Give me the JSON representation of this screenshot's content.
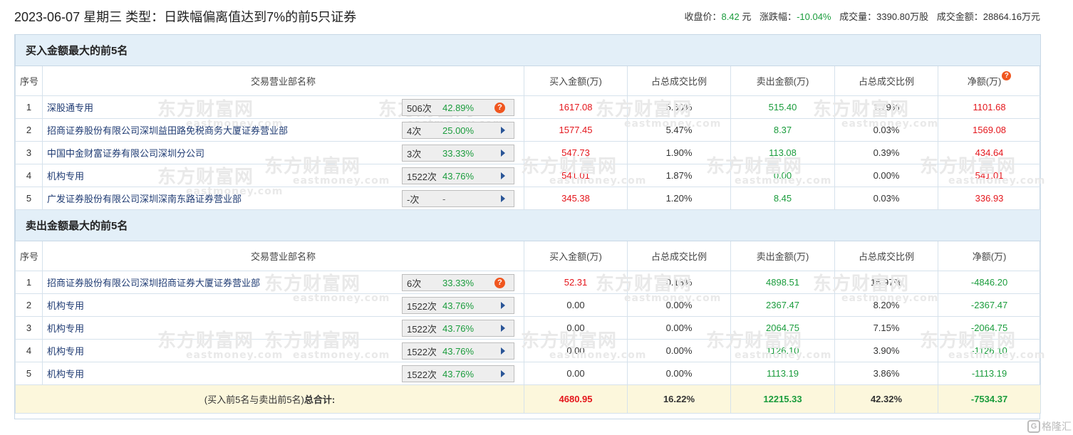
{
  "header": {
    "title": "2023-06-07 星期三 类型：日跌幅偏离值达到7%的前5只证券",
    "close_label": "收盘价：",
    "close_value": "8.42",
    "close_unit": "元",
    "change_label": "涨跌幅：",
    "change_value": "-10.04%",
    "volume_label": "成交量：",
    "volume_value": "3390.80万股",
    "amount_label": "成交金额：",
    "amount_value": "28864.16万元"
  },
  "columns": {
    "idx": "序号",
    "name": "交易营业部名称",
    "buy": "买入金额(万)",
    "buy_ratio": "占总成交比例",
    "sell": "卖出金额(万)",
    "sell_ratio": "占总成交比例",
    "net": "净额(万)"
  },
  "buy_section": {
    "title": "买入金额最大的前5名",
    "rows": [
      {
        "idx": "1",
        "name": "深股通专用",
        "times": "506次",
        "rate": "42.89%",
        "icon": "question-icon",
        "buy": "1617.08",
        "buy_ratio": "5.60%",
        "sell": "515.40",
        "sell_ratio": "1.79%",
        "net": "1101.68"
      },
      {
        "idx": "2",
        "name": "招商证券股份有限公司深圳益田路免税商务大厦证券营业部",
        "times": "4次",
        "rate": "25.00%",
        "icon": "arrow-right-icon",
        "buy": "1577.45",
        "buy_ratio": "5.47%",
        "sell": "8.37",
        "sell_ratio": "0.03%",
        "net": "1569.08"
      },
      {
        "idx": "3",
        "name": "中国中金财富证券有限公司深圳分公司",
        "times": "3次",
        "rate": "33.33%",
        "icon": "arrow-right-icon",
        "buy": "547.73",
        "buy_ratio": "1.90%",
        "sell": "113.08",
        "sell_ratio": "0.39%",
        "net": "434.64"
      },
      {
        "idx": "4",
        "name": "机构专用",
        "times": "1522次",
        "rate": "43.76%",
        "icon": "arrow-right-icon",
        "buy": "541.01",
        "buy_ratio": "1.87%",
        "sell": "0.00",
        "sell_ratio": "0.00%",
        "net": "541.01"
      },
      {
        "idx": "5",
        "name": "广发证券股份有限公司深圳深南东路证券营业部",
        "times": "-次",
        "rate": "-",
        "icon": "arrow-right-icon",
        "buy": "345.38",
        "buy_ratio": "1.20%",
        "sell": "8.45",
        "sell_ratio": "0.03%",
        "net": "336.93"
      }
    ]
  },
  "sell_section": {
    "title": "卖出金额最大的前5名",
    "rows": [
      {
        "idx": "1",
        "name": "招商证券股份有限公司深圳招商证券大厦证券营业部",
        "times": "6次",
        "rate": "33.33%",
        "icon": "question-icon",
        "buy": "52.31",
        "buy_ratio": "0.18%",
        "sell": "4898.51",
        "sell_ratio": "16.97%",
        "net": "-4846.20"
      },
      {
        "idx": "2",
        "name": "机构专用",
        "times": "1522次",
        "rate": "43.76%",
        "icon": "arrow-right-icon",
        "buy": "0.00",
        "buy_ratio": "0.00%",
        "sell": "2367.47",
        "sell_ratio": "8.20%",
        "net": "-2367.47"
      },
      {
        "idx": "3",
        "name": "机构专用",
        "times": "1522次",
        "rate": "43.76%",
        "icon": "arrow-right-icon",
        "buy": "0.00",
        "buy_ratio": "0.00%",
        "sell": "2064.75",
        "sell_ratio": "7.15%",
        "net": "-2064.75"
      },
      {
        "idx": "4",
        "name": "机构专用",
        "times": "1522次",
        "rate": "43.76%",
        "icon": "arrow-right-icon",
        "buy": "0.00",
        "buy_ratio": "0.00%",
        "sell": "1126.10",
        "sell_ratio": "3.90%",
        "net": "-1126.10"
      },
      {
        "idx": "5",
        "name": "机构专用",
        "times": "1522次",
        "rate": "43.76%",
        "icon": "arrow-right-icon",
        "buy": "0.00",
        "buy_ratio": "0.00%",
        "sell": "1113.19",
        "sell_ratio": "3.86%",
        "net": "-1113.19"
      }
    ]
  },
  "total": {
    "label_prefix": "(买入前5名与卖出前5名)",
    "label_bold": "总合计:",
    "buy": "4680.95",
    "buy_ratio": "16.22%",
    "sell": "12215.33",
    "sell_ratio": "42.32%",
    "net": "-7534.37"
  },
  "watermark": {
    "cn": "东方财富网",
    "en": "eastmoney.com"
  },
  "corner_logo": {
    "text": "格隆汇",
    "mark": "G"
  },
  "colors": {
    "up": "#e4161c",
    "down": "#1a9c3c",
    "section_bg": "#e3eff8",
    "total_bg": "#fcf7dc",
    "alert_icon": "#f0561f"
  }
}
